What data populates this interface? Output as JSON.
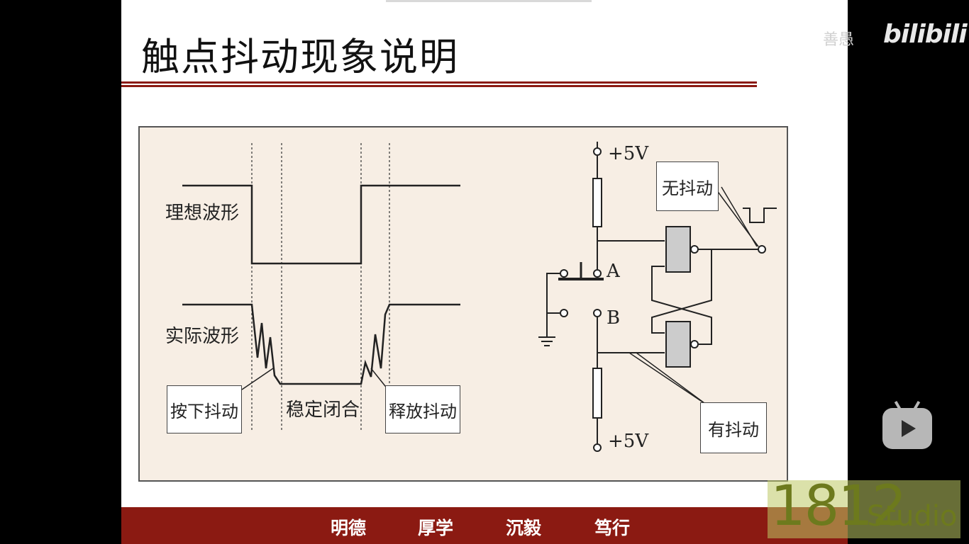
{
  "slide": {
    "title": "触点抖动现象说明",
    "figure": {
      "ideal_waveform_label": "理想波形",
      "actual_waveform_label": "实际波形",
      "press_bounce_label": "按下抖动",
      "stable_closed_label": "稳定闭合",
      "release_bounce_label": "释放抖动",
      "vcc_top_label": "+5V",
      "vcc_bottom_label": "+5V",
      "contact_a_label": "A",
      "contact_b_label": "B",
      "no_bounce_label": "无抖动",
      "has_bounce_label": "有抖动"
    },
    "footer": {
      "mottos": [
        "明德",
        "厚学",
        "沉毅",
        "笃行"
      ]
    }
  },
  "overlay": {
    "uploader_text": "善愚",
    "platform_logo": "bilibili",
    "play_button_icon": "bilibili-play-icon",
    "watermark_number": "1812",
    "watermark_word": "Studio"
  },
  "colors": {
    "accent": "#8b1a12",
    "figure_bg": "#f7eee4",
    "gate_fill": "#cccccc"
  }
}
